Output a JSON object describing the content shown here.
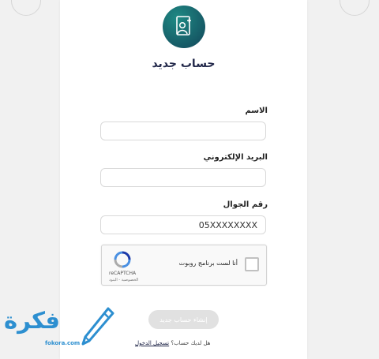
{
  "page": {
    "title": "حساب جديد"
  },
  "form": {
    "name_label": "الاسم",
    "name_value": "",
    "email_label": "البريد الإلكتروني",
    "email_value": "",
    "phone_label": "رقم الجوال",
    "phone_value": "05XXXXXXXX"
  },
  "recaptcha": {
    "checkbox_label": "أنا لست برنامج روبوت",
    "brand": "reCAPTCHA",
    "terms": "الخصوصية - البنود"
  },
  "actions": {
    "submit_label": "إنشاء حساب جديد",
    "login_question": "هل لديك حساب؟",
    "login_link": "تسجيل الدخول"
  },
  "watermark": {
    "logo_text": "فكرة",
    "logo_sub": "fokora.com"
  },
  "colors": {
    "accent": "#165a66",
    "title": "#22284a",
    "logo": "#2d8fd0",
    "button_disabled": "#e1e1e1"
  },
  "icons": {
    "avatar": "user-card-icon",
    "recaptcha": "recaptcha-logo-icon",
    "logo": "pencil-icon"
  }
}
